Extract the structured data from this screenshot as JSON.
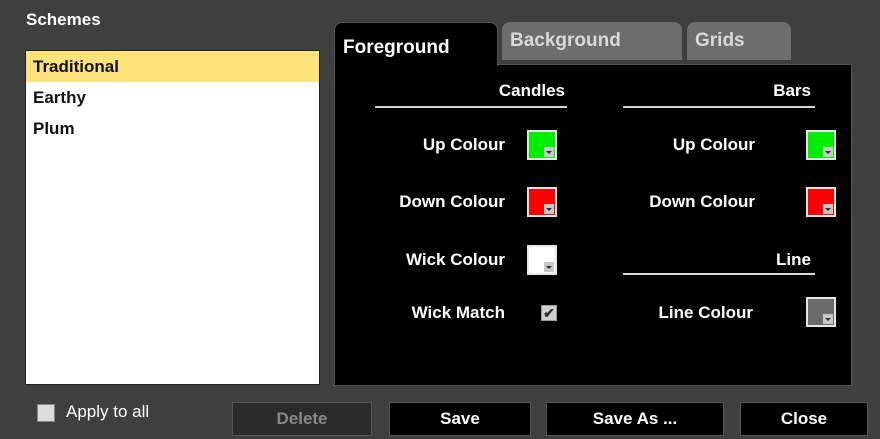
{
  "schemes": {
    "title": "Schemes",
    "items": [
      "Traditional",
      "Earthy",
      "Plum"
    ],
    "selected": "Traditional"
  },
  "tabs": {
    "foreground": "Foreground",
    "background": "Background",
    "grids": "Grids",
    "active": "Foreground"
  },
  "foreground": {
    "candles": {
      "heading": "Candles",
      "up_label": "Up Colour",
      "up_color": "#00ee00",
      "down_label": "Down Colour",
      "down_color": "#ff0000",
      "wick_label": "Wick Colour",
      "wick_color": "#ffffff",
      "wick_match_label": "Wick Match",
      "wick_match_checked": true
    },
    "bars": {
      "heading": "Bars",
      "up_label": "Up Colour",
      "up_color": "#00ee00",
      "down_label": "Down Colour",
      "down_color": "#ff0000"
    },
    "line": {
      "heading": "Line",
      "colour_label": "Line Colour",
      "colour": "#6b6b6b"
    }
  },
  "footer": {
    "apply_label": "Apply to all",
    "apply_checked": false,
    "delete_label": "Delete",
    "save_label": "Save",
    "save_as_label": "Save As ...",
    "close_label": "Close"
  },
  "check_mark": "✔"
}
